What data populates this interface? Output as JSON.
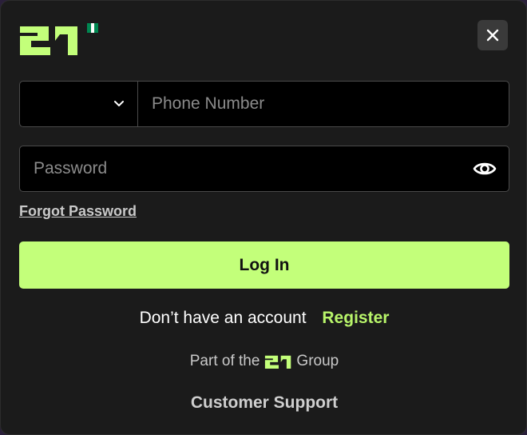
{
  "brand": {
    "logo_text": "21",
    "accent_color": "#c3ff7a",
    "flag_colors": [
      "#008751",
      "#ffffff",
      "#008751"
    ]
  },
  "header": {
    "close_icon": "close-icon"
  },
  "form": {
    "country_select_value": "",
    "phone_placeholder": "Phone Number",
    "password_placeholder": "Password",
    "password_toggle_icon": "eye-icon",
    "forgot_password_label": "Forgot Password",
    "login_label": "Log In"
  },
  "footer": {
    "no_account_text": "Don’t have an account",
    "register_label": "Register",
    "group_prefix": "Part of the",
    "group_suffix": "Group",
    "group_logo_text": "21",
    "support_label": "Customer Support"
  }
}
